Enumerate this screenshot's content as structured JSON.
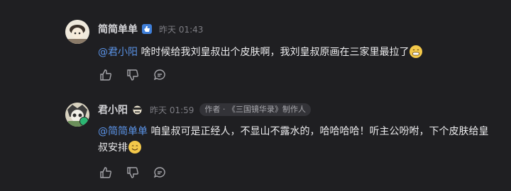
{
  "comments": [
    {
      "username": "简简单单",
      "time": "昨天 01:43",
      "mention": "@君小阳",
      "text": " 啥时候给我刘皇叔出个皮肤啊，我刘皇叔原画在三家里最拉了",
      "emoji": "grinning-emoji"
    },
    {
      "username": "君小阳",
      "time": "昨天 01:59",
      "badge": "作者 · 《三国镜华录》制作人",
      "mention": "@简简单单",
      "text": " 咱皇叔可是正经人，不显山不露水的，哈哈哈哈！听主公吩咐，下个皮肤给皇叔安排",
      "emoji": "smiling-emoji"
    }
  ],
  "icons": {
    "verified": "verified-icon",
    "like": "thumbs-up-icon",
    "dislike": "thumbs-down-icon",
    "reply": "comment-icon",
    "level": "mask-icon"
  },
  "colors": {
    "background": "#1f1f22",
    "mention": "#5b94e8",
    "verified": "#3f7fd9",
    "emoji": "#f3c84a"
  }
}
